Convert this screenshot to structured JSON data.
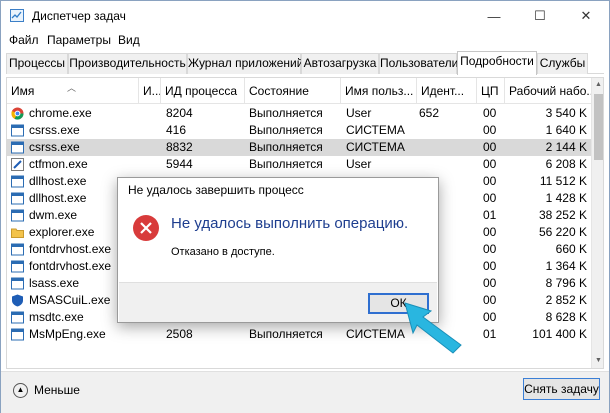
{
  "window": {
    "title": "Диспетчер задач",
    "controls": {
      "minimize": "—",
      "maximize": "☐",
      "close": "✕"
    }
  },
  "menu": [
    "Файл",
    "Параметры",
    "Вид"
  ],
  "tabs": [
    "Процессы",
    "Производительность",
    "Журнал приложений",
    "Автозагрузка",
    "Пользователи",
    "Подробности",
    "Службы"
  ],
  "active_tab": "Подробности",
  "table": {
    "columns": [
      "Имя",
      "И...",
      "ИД процесса",
      "Состояние",
      "Имя польз...",
      "Идент...",
      "ЦП",
      "Рабочий набо..."
    ],
    "rows": [
      {
        "icon": "chrome-icon",
        "name": "chrome.exe",
        "pid": "8204",
        "state": "Выполняется",
        "user": "User",
        "session": "652",
        "cpu": "00",
        "mem": "3 540 K",
        "selected": false
      },
      {
        "icon": "app-icon",
        "name": "csrss.exe",
        "pid": "416",
        "state": "Выполняется",
        "user": "СИСТЕМА",
        "session": "",
        "cpu": "00",
        "mem": "1 640 K",
        "selected": false
      },
      {
        "icon": "app-icon",
        "name": "csrss.exe",
        "pid": "8832",
        "state": "Выполняется",
        "user": "СИСТЕМА",
        "session": "",
        "cpu": "00",
        "mem": "2 144 K",
        "selected": true
      },
      {
        "icon": "pen-icon",
        "name": "ctfmon.exe",
        "pid": "5944",
        "state": "Выполняется",
        "user": "User",
        "session": "",
        "cpu": "00",
        "mem": "6 208 K",
        "selected": false
      },
      {
        "icon": "app-icon",
        "name": "dllhost.exe",
        "pid": "",
        "state": "",
        "user": "",
        "session": "",
        "cpu": "00",
        "mem": "11 512 K",
        "selected": false
      },
      {
        "icon": "app-icon",
        "name": "dllhost.exe",
        "pid": "",
        "state": "",
        "user": "",
        "session": "",
        "cpu": "00",
        "mem": "1 428 K",
        "selected": false
      },
      {
        "icon": "app-icon",
        "name": "dwm.exe",
        "pid": "",
        "state": "",
        "user": "",
        "session": "",
        "cpu": "01",
        "mem": "38 252 K",
        "selected": false
      },
      {
        "icon": "folder-icon",
        "name": "explorer.exe",
        "pid": "",
        "state": "",
        "user": "",
        "session": "",
        "cpu": "00",
        "mem": "56 220 K",
        "selected": false
      },
      {
        "icon": "app-icon",
        "name": "fontdrvhost.exe",
        "pid": "",
        "state": "",
        "user": "",
        "session": "",
        "cpu": "00",
        "mem": "660 K",
        "selected": false
      },
      {
        "icon": "app-icon",
        "name": "fontdrvhost.exe",
        "pid": "",
        "state": "",
        "user": "",
        "session": "",
        "cpu": "00",
        "mem": "1 364 K",
        "selected": false
      },
      {
        "icon": "app-icon",
        "name": "lsass.exe",
        "pid": "",
        "state": "",
        "user": "",
        "session": "",
        "cpu": "00",
        "mem": "8 796 K",
        "selected": false
      },
      {
        "icon": "shield-icon",
        "name": "MSASCuiL.exe",
        "pid": "",
        "state": "",
        "user": "",
        "session": "",
        "cpu": "00",
        "mem": "2 852 K",
        "selected": false
      },
      {
        "icon": "app-icon",
        "name": "msdtc.exe",
        "pid": "",
        "state": "",
        "user": "",
        "session": "",
        "cpu": "00",
        "mem": "8 628 K",
        "selected": false
      },
      {
        "icon": "app-icon",
        "name": "MsMpEng.exe",
        "pid": "2508",
        "state": "Выполняется",
        "user": "СИСТЕМА",
        "session": "",
        "cpu": "01",
        "mem": "101 400 K",
        "selected": false
      }
    ]
  },
  "bottom": {
    "less_label": "Меньше",
    "end_task_label": "Снять задачу"
  },
  "dialog": {
    "title": "Не удалось завершить процесс",
    "message": "Не удалось выполнить операцию.",
    "detail": "Отказано в доступе.",
    "ok_label": "ОК"
  },
  "colors": {
    "accent": "#2f6fd0",
    "error": "#d83b3b",
    "pointer": "#29b6e0",
    "selection": "#d9d9d9"
  }
}
